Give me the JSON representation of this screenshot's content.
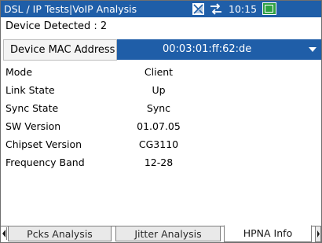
{
  "titlebar": {
    "title": "DSL / IP Tests|VoIP Analysis",
    "clock": "10:15",
    "icons": [
      "signal-icon",
      "network-icon",
      "battery-icon"
    ]
  },
  "device_detected": "Device Detected : 2",
  "mac": {
    "label": "Device MAC Address",
    "value": "00:03:01:ff:62:de"
  },
  "info": [
    {
      "label": "Mode",
      "value": "Client"
    },
    {
      "label": "Link State",
      "value": "Up"
    },
    {
      "label": "Sync State",
      "value": "Sync"
    },
    {
      "label": "SW Version",
      "value": "01.07.05"
    },
    {
      "label": "Chipset Version",
      "value": "CG3110"
    },
    {
      "label": "Frequency Band",
      "value": "12-28"
    }
  ],
  "tabs": [
    {
      "label": "Pcks Analysis"
    },
    {
      "label": "Jitter Analysis"
    },
    {
      "label": "HPNA Info"
    }
  ],
  "colors": {
    "titlebar": "#1f5ea8",
    "selected": "#1f5ea8",
    "battery": "#2ea043"
  }
}
